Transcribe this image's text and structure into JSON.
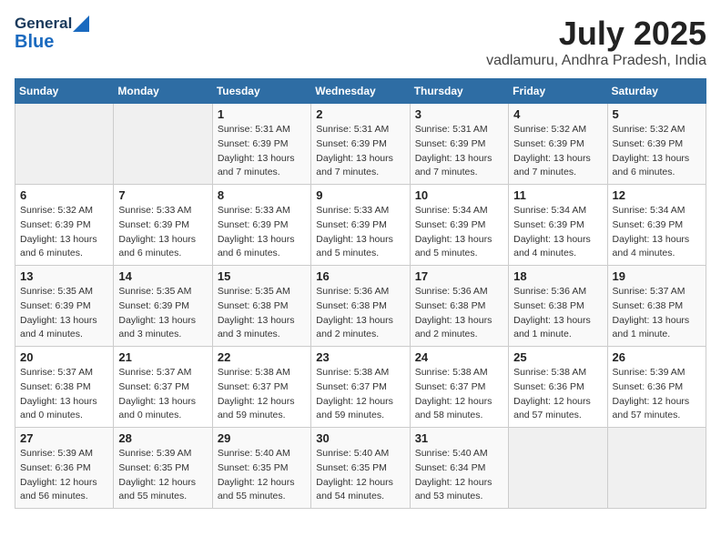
{
  "logo": {
    "general": "General",
    "blue": "Blue"
  },
  "title": "July 2025",
  "subtitle": "vadlamuru, Andhra Pradesh, India",
  "weekdays": [
    "Sunday",
    "Monday",
    "Tuesday",
    "Wednesday",
    "Thursday",
    "Friday",
    "Saturday"
  ],
  "weeks": [
    [
      {
        "day": "",
        "detail": ""
      },
      {
        "day": "",
        "detail": ""
      },
      {
        "day": "1",
        "detail": "Sunrise: 5:31 AM\nSunset: 6:39 PM\nDaylight: 13 hours\nand 7 minutes."
      },
      {
        "day": "2",
        "detail": "Sunrise: 5:31 AM\nSunset: 6:39 PM\nDaylight: 13 hours\nand 7 minutes."
      },
      {
        "day": "3",
        "detail": "Sunrise: 5:31 AM\nSunset: 6:39 PM\nDaylight: 13 hours\nand 7 minutes."
      },
      {
        "day": "4",
        "detail": "Sunrise: 5:32 AM\nSunset: 6:39 PM\nDaylight: 13 hours\nand 7 minutes."
      },
      {
        "day": "5",
        "detail": "Sunrise: 5:32 AM\nSunset: 6:39 PM\nDaylight: 13 hours\nand 6 minutes."
      }
    ],
    [
      {
        "day": "6",
        "detail": "Sunrise: 5:32 AM\nSunset: 6:39 PM\nDaylight: 13 hours\nand 6 minutes."
      },
      {
        "day": "7",
        "detail": "Sunrise: 5:33 AM\nSunset: 6:39 PM\nDaylight: 13 hours\nand 6 minutes."
      },
      {
        "day": "8",
        "detail": "Sunrise: 5:33 AM\nSunset: 6:39 PM\nDaylight: 13 hours\nand 6 minutes."
      },
      {
        "day": "9",
        "detail": "Sunrise: 5:33 AM\nSunset: 6:39 PM\nDaylight: 13 hours\nand 5 minutes."
      },
      {
        "day": "10",
        "detail": "Sunrise: 5:34 AM\nSunset: 6:39 PM\nDaylight: 13 hours\nand 5 minutes."
      },
      {
        "day": "11",
        "detail": "Sunrise: 5:34 AM\nSunset: 6:39 PM\nDaylight: 13 hours\nand 4 minutes."
      },
      {
        "day": "12",
        "detail": "Sunrise: 5:34 AM\nSunset: 6:39 PM\nDaylight: 13 hours\nand 4 minutes."
      }
    ],
    [
      {
        "day": "13",
        "detail": "Sunrise: 5:35 AM\nSunset: 6:39 PM\nDaylight: 13 hours\nand 4 minutes."
      },
      {
        "day": "14",
        "detail": "Sunrise: 5:35 AM\nSunset: 6:39 PM\nDaylight: 13 hours\nand 3 minutes."
      },
      {
        "day": "15",
        "detail": "Sunrise: 5:35 AM\nSunset: 6:38 PM\nDaylight: 13 hours\nand 3 minutes."
      },
      {
        "day": "16",
        "detail": "Sunrise: 5:36 AM\nSunset: 6:38 PM\nDaylight: 13 hours\nand 2 minutes."
      },
      {
        "day": "17",
        "detail": "Sunrise: 5:36 AM\nSunset: 6:38 PM\nDaylight: 13 hours\nand 2 minutes."
      },
      {
        "day": "18",
        "detail": "Sunrise: 5:36 AM\nSunset: 6:38 PM\nDaylight: 13 hours\nand 1 minute."
      },
      {
        "day": "19",
        "detail": "Sunrise: 5:37 AM\nSunset: 6:38 PM\nDaylight: 13 hours\nand 1 minute."
      }
    ],
    [
      {
        "day": "20",
        "detail": "Sunrise: 5:37 AM\nSunset: 6:38 PM\nDaylight: 13 hours\nand 0 minutes."
      },
      {
        "day": "21",
        "detail": "Sunrise: 5:37 AM\nSunset: 6:37 PM\nDaylight: 13 hours\nand 0 minutes."
      },
      {
        "day": "22",
        "detail": "Sunrise: 5:38 AM\nSunset: 6:37 PM\nDaylight: 12 hours\nand 59 minutes."
      },
      {
        "day": "23",
        "detail": "Sunrise: 5:38 AM\nSunset: 6:37 PM\nDaylight: 12 hours\nand 59 minutes."
      },
      {
        "day": "24",
        "detail": "Sunrise: 5:38 AM\nSunset: 6:37 PM\nDaylight: 12 hours\nand 58 minutes."
      },
      {
        "day": "25",
        "detail": "Sunrise: 5:38 AM\nSunset: 6:36 PM\nDaylight: 12 hours\nand 57 minutes."
      },
      {
        "day": "26",
        "detail": "Sunrise: 5:39 AM\nSunset: 6:36 PM\nDaylight: 12 hours\nand 57 minutes."
      }
    ],
    [
      {
        "day": "27",
        "detail": "Sunrise: 5:39 AM\nSunset: 6:36 PM\nDaylight: 12 hours\nand 56 minutes."
      },
      {
        "day": "28",
        "detail": "Sunrise: 5:39 AM\nSunset: 6:35 PM\nDaylight: 12 hours\nand 55 minutes."
      },
      {
        "day": "29",
        "detail": "Sunrise: 5:40 AM\nSunset: 6:35 PM\nDaylight: 12 hours\nand 55 minutes."
      },
      {
        "day": "30",
        "detail": "Sunrise: 5:40 AM\nSunset: 6:35 PM\nDaylight: 12 hours\nand 54 minutes."
      },
      {
        "day": "31",
        "detail": "Sunrise: 5:40 AM\nSunset: 6:34 PM\nDaylight: 12 hours\nand 53 minutes."
      },
      {
        "day": "",
        "detail": ""
      },
      {
        "day": "",
        "detail": ""
      }
    ]
  ]
}
